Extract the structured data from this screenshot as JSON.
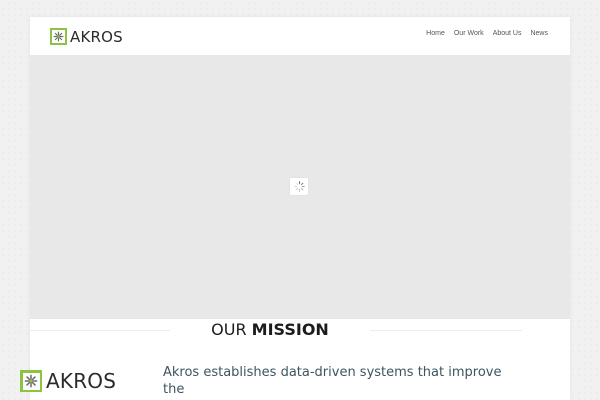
{
  "brand": {
    "name": "AKROS",
    "accent_color": "#8bc53f",
    "logo_icon": "asterisk-icon"
  },
  "nav": {
    "items": [
      {
        "label": "Home"
      },
      {
        "label": "Our Work"
      },
      {
        "label": "About Us"
      },
      {
        "label": "News"
      }
    ]
  },
  "hero": {
    "loader_icon": "spinner-icon",
    "background_color": "#e8e8e8"
  },
  "mission": {
    "title_light": "OUR ",
    "title_bold": "MISSION",
    "text": "Akros establishes data-driven systems that improve the"
  }
}
